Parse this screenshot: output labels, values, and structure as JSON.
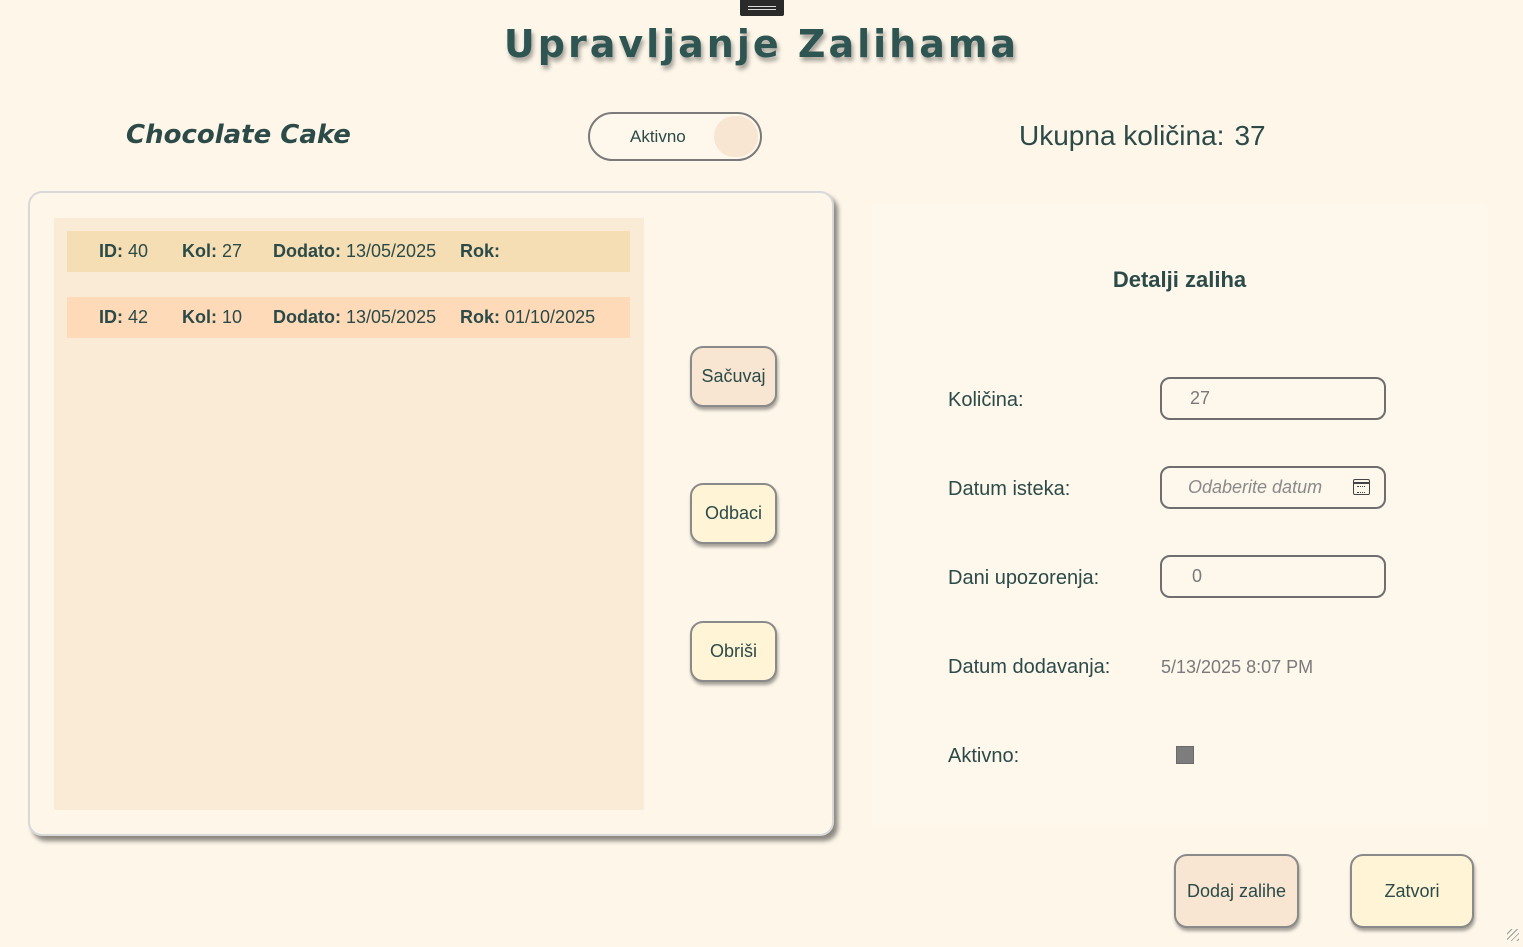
{
  "header": {
    "title": "Upravljanje Zalihama",
    "product_name": "Chocolate Cake",
    "status_toggle_label": "Aktivno",
    "total_label": "Ukupna količina:",
    "total_value": "37"
  },
  "batches": {
    "rows": [
      {
        "id_label": "ID:",
        "id": "40",
        "kol_label": "Kol:",
        "kol": "27",
        "dodato_label": "Dodato:",
        "dodato": "13/05/2025",
        "rok_label": "Rok:",
        "rok": ""
      },
      {
        "id_label": "ID:",
        "id": "42",
        "kol_label": "Kol:",
        "kol": "10",
        "dodato_label": "Dodato:",
        "dodato": "13/05/2025",
        "rok_label": "Rok:",
        "rok": "01/10/2025"
      }
    ],
    "buttons": {
      "save": "Sačuvaj",
      "discard": "Odbaci",
      "delete": "Obriši"
    }
  },
  "details": {
    "title": "Detalji zaliha",
    "quantity_label": "Količina:",
    "quantity_value": "27",
    "expiry_label": "Datum isteka:",
    "expiry_placeholder": "Odaberite datum",
    "warning_days_label": "Dani upozorenja:",
    "warning_days_value": "0",
    "date_added_label": "Datum dodavanja:",
    "date_added_value": "5/13/2025 8:07 PM",
    "active_label": "Aktivno:",
    "active_checked": false
  },
  "footer": {
    "add_stock": "Dodaj zalihe",
    "close": "Zatvori"
  },
  "colors": {
    "background": "#fdf6e9",
    "text": "#2b4a48",
    "row_selected": "#f5deb3",
    "row_alt": "#ffdab9",
    "list_bg": "#faebd7"
  }
}
